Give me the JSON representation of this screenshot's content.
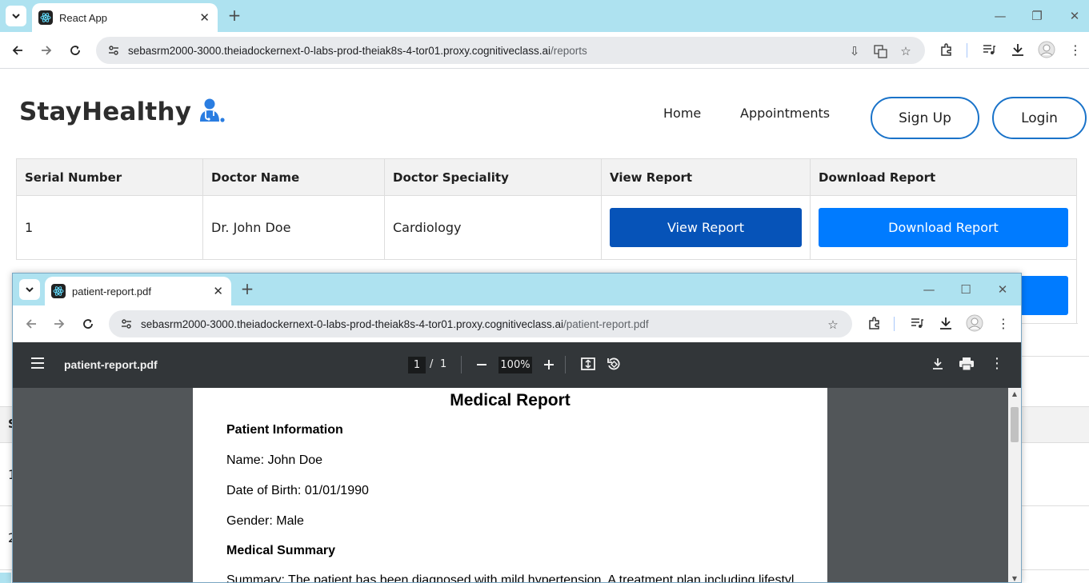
{
  "browser": {
    "tab_title": "React App",
    "url_host": "sebasrm2000-3000.theiadockernext-0-labs-prod-theiak8s-4-tor01.proxy.cognitiveclass.ai",
    "url_path": "/reports"
  },
  "site": {
    "brand": "StayHealthy",
    "nav": {
      "home": "Home",
      "appointments": "Appointments"
    },
    "signup": "Sign Up",
    "login": "Login"
  },
  "table": {
    "headers": [
      "Serial Number",
      "Doctor Name",
      "Doctor Speciality",
      "View Report",
      "Download Report"
    ],
    "rows": [
      {
        "serial": "1",
        "doctor": "Dr. John Doe",
        "speciality": "Cardiology",
        "view": "View Report",
        "download": "Download Report"
      }
    ],
    "partial_rows": [
      "1",
      "2"
    ],
    "partial_header": "S"
  },
  "popup": {
    "tab_title": "patient-report.pdf",
    "url_host": "sebasrm2000-3000.theiadockernext-0-labs-prod-theiak8s-4-tor01.proxy.cognitiveclass.ai",
    "url_path": "/patient-report.pdf",
    "pdf_toolbar": {
      "file_name": "patient-report.pdf",
      "current_page": "1",
      "separator": "/",
      "total_pages": "1",
      "zoom": "100%"
    },
    "document": {
      "title": "Medical Report",
      "patient_info_heading": "Patient Information",
      "name": "Name: John Doe",
      "dob": "Date of Birth: 01/01/1990",
      "gender": "Gender: Male",
      "summary_heading": "Medical Summary",
      "summary": "Summary: The patient has been diagnosed with mild hypertension. A treatment plan including lifestyle"
    }
  },
  "colors": {
    "tabbar": "#aee2f0",
    "view_button": "#0653b8",
    "download_button": "#007bff",
    "pill_border": "#1a73c9",
    "pdf_toolbar": "#323639",
    "pdf_background": "#525659"
  }
}
